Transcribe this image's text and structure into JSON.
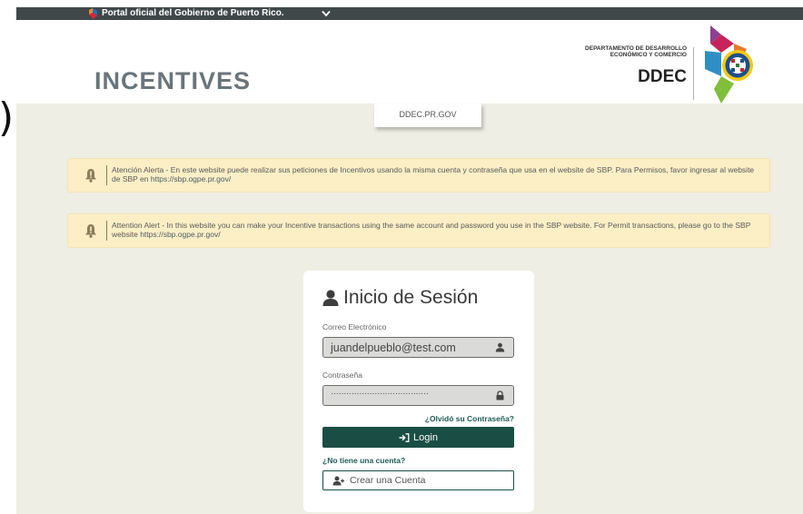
{
  "gov_bar": {
    "text": "Portal oficial del Gobierno de Puerto Rico."
  },
  "header": {
    "app_title": "INCENTIVES",
    "agency_line1": "DEPARTAMENTO DE DESARROLLO",
    "agency_line2": "ECONÓMICO Y COMERCIO",
    "agency_short": "DDEC"
  },
  "site_tab": {
    "label": "DDEC.PR.GOV"
  },
  "alerts": [
    {
      "text": "Atención Alerta - En este website puede realizar sus peticiones de Incentivos usando la misma cuenta y contraseña que usa en el website de SBP. Para Permisos, favor ingresar al website de SBP en ",
      "link": "https://sbp.ogpe.pr.gov/"
    },
    {
      "text": "Attention Alert - In this website you can make your Incentive transactions using the same account and password you use in the SBP website. For Permit transactions, please go to the SBP website ",
      "link": "https://sbp.ogpe.pr.gov/"
    }
  ],
  "login": {
    "title": "Inicio de Sesión",
    "email_label": "Correo Electrónico",
    "email_value": "juandelpueblo@test.com",
    "password_label": "Contraseña",
    "password_value": "······································",
    "forgot_link": "¿Olvidó su Contraseña?",
    "login_button": "Login",
    "no_account": "¿No tiene una cuenta?",
    "create_account": "Crear una Cuenta"
  },
  "colors": {
    "primary": "#1a4e44",
    "link": "#1d5d55",
    "alert_bg": "#fcefc6",
    "page_bg": "#efeee4",
    "gov_bar": "#40484a"
  },
  "icons": {
    "gov_flag": "pr-flag-icon",
    "gov_chevron": "chevron-down-icon",
    "alert": "bell-icon",
    "user": "user-icon",
    "email_field": "user-small-icon",
    "password_field": "lock-icon",
    "login": "sign-in-icon",
    "create": "user-plus-icon"
  }
}
